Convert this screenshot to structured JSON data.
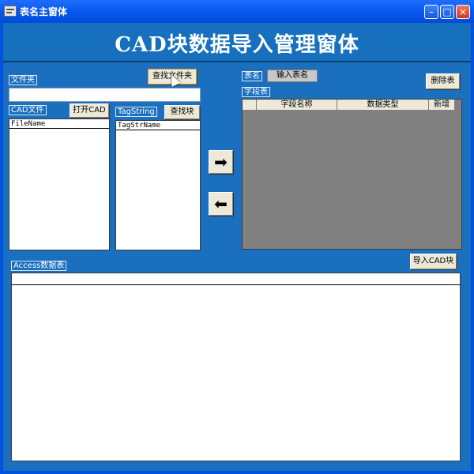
{
  "window": {
    "title": "表名主窗体",
    "minimize": "–",
    "maximize": "□",
    "close": "×"
  },
  "header": {
    "title": "CAD块数据导入管理窗体"
  },
  "folder": {
    "label": "文件夹",
    "find_button": "查找文件夹",
    "value": ""
  },
  "cad_files": {
    "label": "CAD文件",
    "open_button": "打开CAD",
    "column": "FileName"
  },
  "tag_string": {
    "label": "TagString",
    "find_button": "查找块",
    "column": "TagStrName"
  },
  "arrows": {
    "right": "➡",
    "left": "⬅"
  },
  "table_name": {
    "label": "表名",
    "value": "输入表名",
    "delete_button": "删除表"
  },
  "fields_table": {
    "label": "字段表",
    "columns": [
      "",
      "字段名称",
      "数据类型",
      "新增"
    ]
  },
  "access": {
    "label": "Access数据表",
    "import_button": "导入CAD块"
  }
}
